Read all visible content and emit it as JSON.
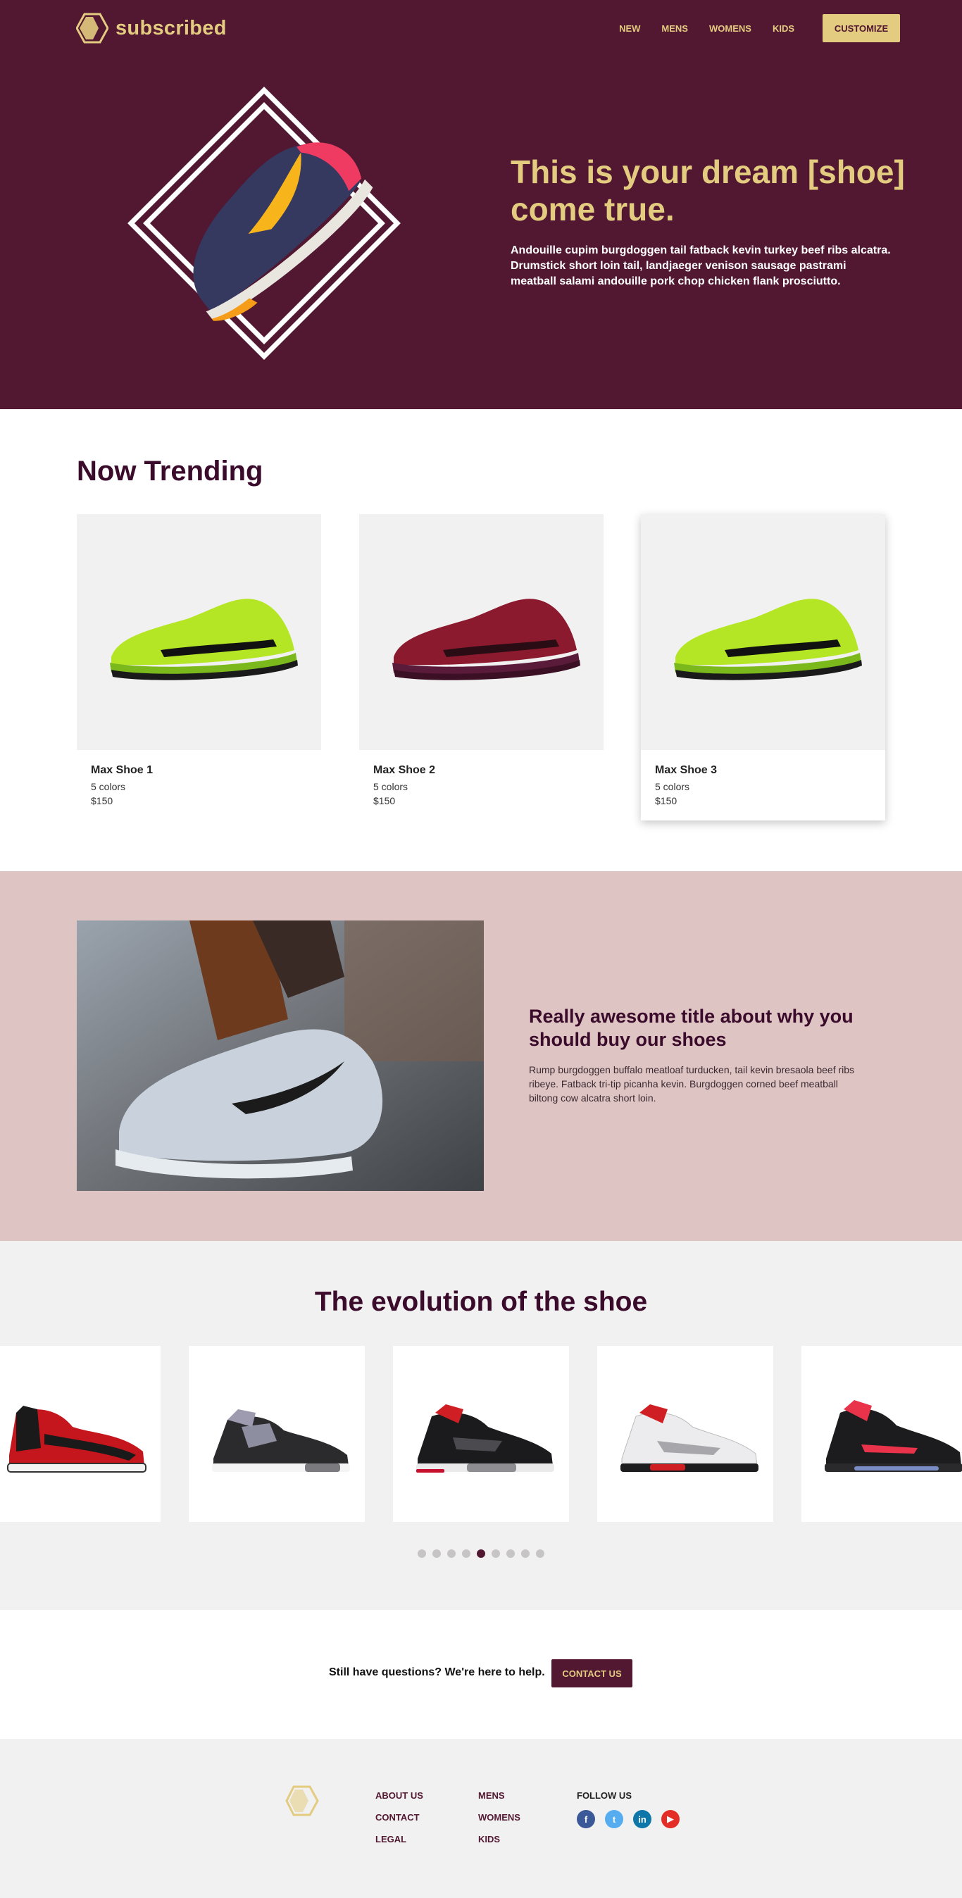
{
  "brand": {
    "name": "subscribed"
  },
  "nav": {
    "items": [
      "NEW",
      "MENS",
      "WOMENS",
      "KIDS"
    ],
    "customize_label": "CUSTOMIZE"
  },
  "hero": {
    "title": "This is your dream [shoe] come true.",
    "text": "Andouille cupim burgdoggen tail fatback kevin turkey beef ribs alcatra. Drumstick short loin tail, landjaeger venison sausage pastrami meatball salami andouille pork chop chicken flank prosciutto."
  },
  "trending": {
    "title": "Now Trending",
    "items": [
      {
        "name": "Max Shoe 1",
        "colors": "5 colors",
        "price": "$150"
      },
      {
        "name": "Max Shoe 2",
        "colors": "5 colors",
        "price": "$150"
      },
      {
        "name": "Max Shoe 3",
        "colors": "5 colors",
        "price": "$150"
      }
    ]
  },
  "feature": {
    "title": "Really awesome title about why you should buy our shoes",
    "text": "Rump burgdoggen buffalo meatloaf turducken, tail kevin bresaola beef ribs ribeye. Fatback tri-tip picanha kevin. Burgdoggen corned beef meatball biltong cow alcatra short loin."
  },
  "evolution": {
    "title": "The evolution of the shoe",
    "dot_count": 9,
    "active_dot": 5
  },
  "cta": {
    "text": "Still have questions? We're here to help.",
    "button_label": "CONTACT US"
  },
  "footer": {
    "col1": [
      "ABOUT US",
      "CONTACT",
      "LEGAL"
    ],
    "col2": [
      "MENS",
      "WOMENS",
      "KIDS"
    ],
    "follow_title": "FOLLOW US",
    "socials": [
      {
        "icon": "facebook-icon",
        "glyph": "f",
        "color": "#3b5998"
      },
      {
        "icon": "twitter-icon",
        "glyph": "t",
        "color": "#55acee"
      },
      {
        "icon": "linkedin-icon",
        "glyph": "in",
        "color": "#0e76a8"
      },
      {
        "icon": "youtube-icon",
        "glyph": "▶",
        "color": "#e52d27"
      }
    ]
  },
  "colors": {
    "plum": "#521731",
    "gold": "#e3cb80",
    "blush": "#dfc4c4",
    "light": "#f2f1f2"
  }
}
